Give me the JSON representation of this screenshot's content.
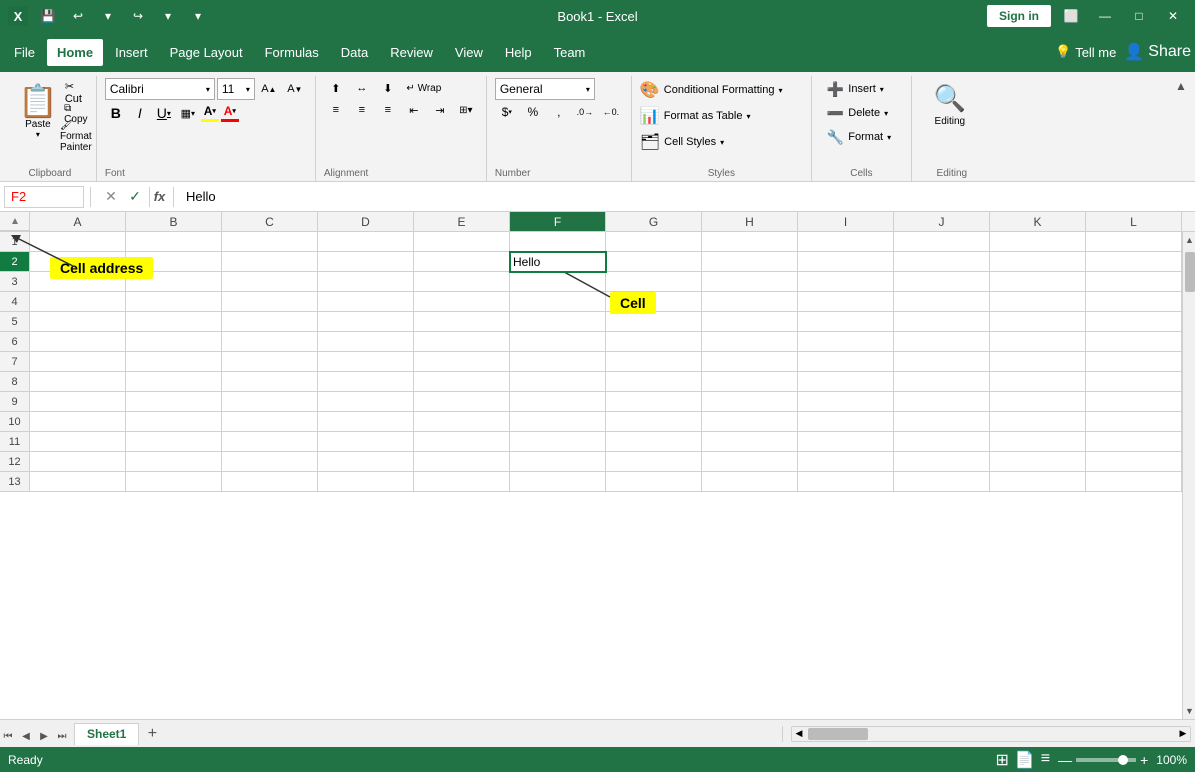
{
  "titlebar": {
    "app_title": "Book1 - Excel",
    "save_icon": "💾",
    "undo_icon": "↩",
    "redo_icon": "↪",
    "more_icon": "▾",
    "restore_icon": "⬜",
    "minimize_icon": "—",
    "maximize_icon": "□",
    "close_icon": "✕",
    "signin_label": "Sign in"
  },
  "menubar": {
    "items": [
      {
        "label": "File",
        "active": false
      },
      {
        "label": "Home",
        "active": true
      },
      {
        "label": "Insert",
        "active": false
      },
      {
        "label": "Page Layout",
        "active": false
      },
      {
        "label": "Formulas",
        "active": false
      },
      {
        "label": "Data",
        "active": false
      },
      {
        "label": "Review",
        "active": false
      },
      {
        "label": "View",
        "active": false
      },
      {
        "label": "Help",
        "active": false
      },
      {
        "label": "Team",
        "active": false
      }
    ],
    "light_icon": "💡",
    "tell_me_label": "Tell me",
    "share_icon": "👤",
    "share_label": "Share"
  },
  "ribbon": {
    "clipboard_label": "Clipboard",
    "font_label": "Font",
    "alignment_label": "Alignment",
    "number_label": "Number",
    "styles_label": "Styles",
    "cells_label": "Cells",
    "editing_label": "Editing",
    "paste_icon": "📋",
    "paste_label": "Paste",
    "cut_icon": "✂",
    "copy_icon": "⧉",
    "format_painter_icon": "🖌",
    "font_name": "Calibri",
    "font_size": "11",
    "bold_label": "B",
    "italic_label": "I",
    "underline_label": "U",
    "font_increase_label": "A↑",
    "font_decrease_label": "A↓",
    "border_label": "▦",
    "fill_color_label": "A",
    "font_color_label": "A",
    "align_left": "≡",
    "align_center": "≡",
    "align_right": "≡",
    "align_top": "⬆",
    "align_middle": "↔",
    "align_bottom": "⬇",
    "wrap_text": "↵",
    "merge_label": "⊞",
    "number_format": "General",
    "percent": "%",
    "comma": ",",
    "increase_dec": ".0",
    "decrease_dec": "0.",
    "accounting": "$",
    "cond_format_label": "Conditional Formatting",
    "format_table_label": "Format as Table",
    "cell_styles_label": "Cell Styles",
    "insert_label": "Insert",
    "delete_label": "Delete",
    "format_label": "Format",
    "editing_icon": "🔍",
    "editing_btn_label": "Editing"
  },
  "formula_bar": {
    "cell_ref": "F2",
    "cancel_icon": "✕",
    "confirm_icon": "✓",
    "fx_label": "fx",
    "formula_content": "Hello"
  },
  "spreadsheet": {
    "columns": [
      "A",
      "B",
      "C",
      "D",
      "E",
      "F",
      "G",
      "H",
      "I",
      "J",
      "K",
      "L"
    ],
    "rows": [
      "1",
      "2",
      "3",
      "4",
      "5",
      "6",
      "7",
      "8",
      "9",
      "10",
      "11",
      "12",
      "13"
    ],
    "active_cell": {
      "row": 2,
      "col": 5
    },
    "active_cell_value": "Hello"
  },
  "annotations": {
    "cell_address_label": "Cell address",
    "cell_label": "Cell"
  },
  "statusbar": {
    "ready_label": "Ready",
    "grid_icon": "⊞",
    "page_icon": "📄",
    "custom_icon": "≡",
    "zoom_minus": "—",
    "zoom_plus": "+",
    "zoom_level": "100%"
  },
  "sheet_tabs": {
    "active_tab": "Sheet1",
    "add_icon": "+"
  }
}
